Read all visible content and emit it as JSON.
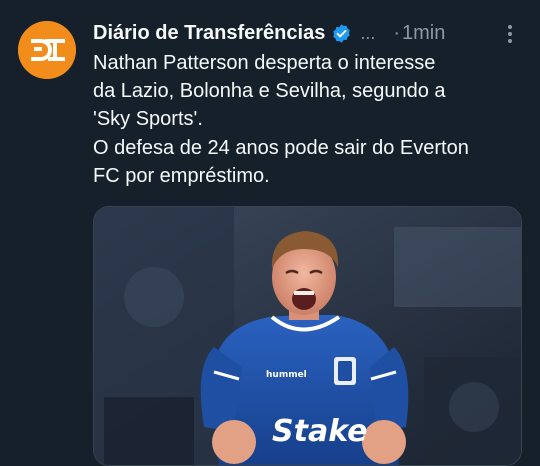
{
  "account": {
    "name": "Diário de Transferências",
    "avatar_icon": "dt-logo-icon",
    "avatar_color": "#f28c1a",
    "verified_icon": "verified-badge-icon",
    "verified_color": "#1d9bf0",
    "ellipsis": "...",
    "separator": "·",
    "time": "1min"
  },
  "menu_icon": "more-options-icon",
  "tweet": {
    "lines": [
      "Nathan Patterson desperta o interesse",
      "da Lazio, Bolonha e Sevilha, segundo a",
      "'Sky Sports'.",
      "O defesa de 24 anos pode sair do Everton",
      "FC por empréstimo."
    ]
  },
  "media": {
    "kind": "photo",
    "shirt_sponsor": "Stake",
    "kit_maker": "hummel",
    "shirt_color": "#1f4fa3"
  }
}
